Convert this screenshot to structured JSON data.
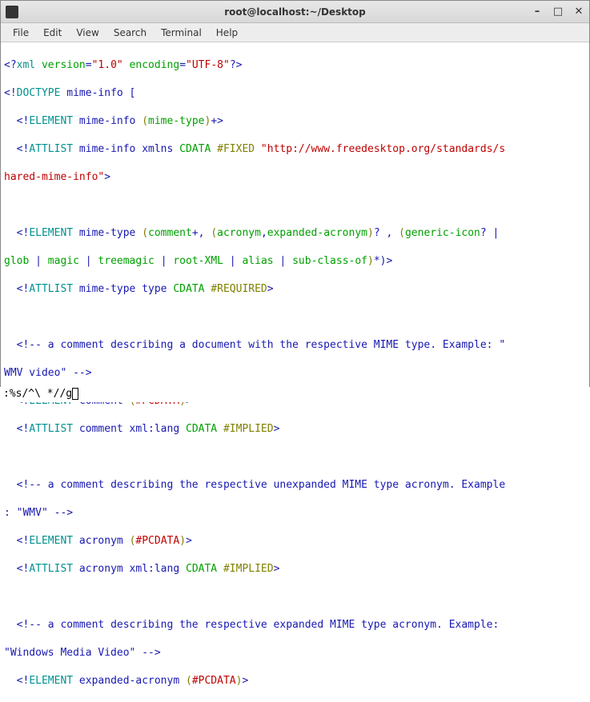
{
  "window": {
    "title": "root@localhost:~/Desktop"
  },
  "menu": {
    "file": "File",
    "edit": "Edit",
    "view": "View",
    "search": "Search",
    "terminal": "Terminal",
    "help": "Help"
  },
  "xml": {
    "decl_open": "<?",
    "decl_xml": "xml",
    "decl_version_attr": " version",
    "decl_eq": "=",
    "decl_version_val": "\"1.0\"",
    "decl_encoding_attr": " encoding",
    "decl_encoding_val": "\"UTF-8\"",
    "decl_close": "?>",
    "doctype_open": "<!",
    "doctype_kw": "DOCTYPE",
    "doctype_name": " mime-info [",
    "el_kw": "ELEMENT",
    "att_kw": "ATTLIST",
    "mimeinfo_el_name": " mime-info ",
    "mimeinfo_children_open": "(",
    "mimeinfo_children": "mime-type",
    "mimeinfo_children_close": ")",
    "mimeinfo_plus": "+>",
    "mimeinfo_att_name": " mime-info xmlns ",
    "cdata": "CDATA",
    "fixed": " #FIXED",
    "ns_url_a": " \"http://www.freedesktop.org/standards/s",
    "ns_url_b": "hared-mime-info\"",
    "ns_close": ">",
    "mimetype_el_name": " mime-type ",
    "mimetype_children_a_open": "(",
    "mimetype_comment": "comment",
    "mimetype_plus2": "+, ",
    "mimetype_paren2_open": "(",
    "mimetype_acronym": "acronym",
    "mimetype_comma": ",",
    "mimetype_expacro": "expanded-acronym",
    "mimetype_paren2_close": ")",
    "mimetype_q": "? , ",
    "mimetype_paren3_open": "(",
    "mimetype_genicon": "generic-icon",
    "mimetype_q2": "? |",
    "mimetype_line2_pre": "",
    "mimetype_glob": "glob",
    "mimetype_pipe": " | ",
    "mimetype_magic": "magic",
    "mimetype_treemagic": "treemagic",
    "mimetype_rootxml": "root-XML",
    "mimetype_alias": "alias",
    "mimetype_subclass": "sub-class-of",
    "mimetype_paren3_close": ")",
    "mimetype_star": "*)>",
    "mimetype_att_name": " mime-type type ",
    "required": " #REQUIRED",
    "cmt_open": "<!-- ",
    "cmt_close": " -->",
    "cmt1a": "a comment describing a document with the respective MIME type. Example: \"",
    "cmt1b": "WMV video\"",
    "comment_el_name": " comment ",
    "pcdata_open": "(",
    "pcdata": "#PCDATA",
    "pcdata_close": ")>",
    "comment_att_name": " comment xml:lang ",
    "implied": " #IMPLIED",
    "cmt2a": "a comment describing the respective unexpanded MIME type acronym. Example",
    "cmt2b": ": \"WMV\"",
    "acronym_el_name": " acronym ",
    "acronym_att_name": " acronym xml:lang ",
    "cmt3a": "a comment describing the respective expanded MIME type acronym. Example:",
    "cmt3b": "\"Windows Media Video\"",
    "expacro_el_name": " expanded-acronym ",
    "indent": "  ",
    "space": " "
  },
  "command": {
    "text": ":%s/^\\ *//g"
  }
}
